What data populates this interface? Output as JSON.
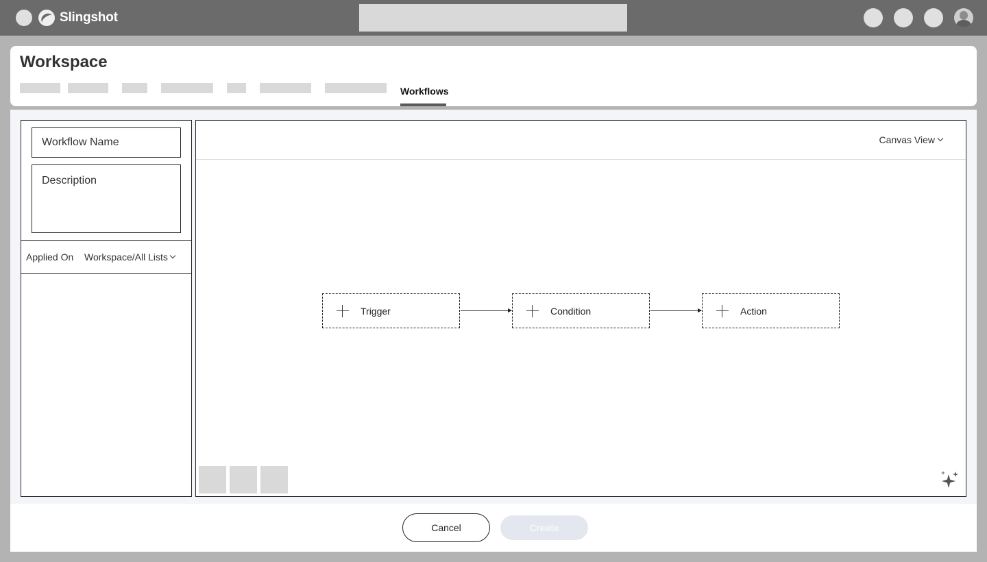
{
  "app": {
    "name": "Slingshot"
  },
  "topbar": {
    "search": {
      "value": "",
      "placeholder": ""
    },
    "icons": [
      "menu-circle-icon",
      "circle-icon",
      "circle-icon",
      "circle-icon",
      "user-avatar"
    ]
  },
  "workspace": {
    "title": "Workspace",
    "tabs": [
      {
        "label": "",
        "placeholder": true
      },
      {
        "label": "",
        "placeholder": true
      },
      {
        "label": "",
        "placeholder": true
      },
      {
        "label": "",
        "placeholder": true
      },
      {
        "label": "",
        "placeholder": true
      },
      {
        "label": "",
        "placeholder": true
      },
      {
        "label": "",
        "placeholder": true
      },
      {
        "label": "Workflows",
        "active": true
      }
    ]
  },
  "form": {
    "workflow_name": {
      "placeholder": "Workflow Name",
      "value": ""
    },
    "description": {
      "placeholder": "Description",
      "value": ""
    },
    "applied_on": {
      "label": "Applied On",
      "value": "Workspace/All Lists"
    }
  },
  "canvas": {
    "view_selector": "Canvas View",
    "nodes": [
      {
        "label": "Trigger"
      },
      {
        "label": "Condition"
      },
      {
        "label": "Action"
      }
    ]
  },
  "footer": {
    "cancel_label": "Cancel",
    "create_label": "Create",
    "create_enabled": false
  },
  "colors": {
    "topbar": "#6b6b6b",
    "placeholder_gray": "#d9d9d9",
    "main_bg": "#f3f5f9",
    "create_disabled": "#e4e7ef"
  }
}
